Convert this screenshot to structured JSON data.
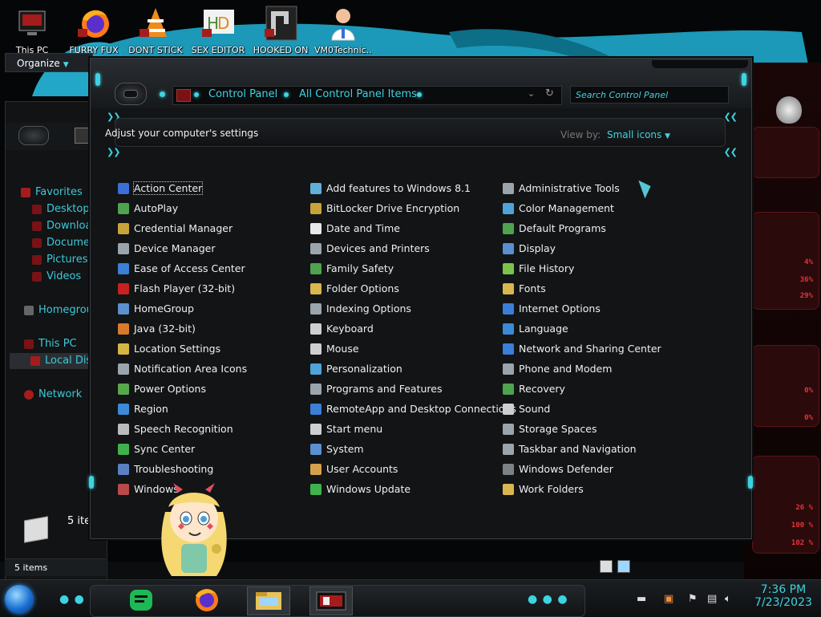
{
  "desktop": {
    "icons": [
      {
        "label": "This PC",
        "icon": "pc-icon"
      },
      {
        "label": "FURRY FUX",
        "icon": "firefox-shortcut-icon"
      },
      {
        "label": "DONT STICK",
        "icon": "vlc-shortcut-icon"
      },
      {
        "label": "SEX EDITOR",
        "icon": "hxd-shortcut-icon"
      },
      {
        "label": "HOOKED ON",
        "icon": "game-shortcut-icon"
      },
      {
        "label": "VM0Technic...",
        "icon": "doctor-avatar-icon"
      }
    ]
  },
  "background_explorer": {
    "organize_label": "Organize",
    "nav": [
      {
        "label": "Favorites",
        "icon": "star-icon"
      },
      {
        "label": "Desktop",
        "icon": "desktop-icon"
      },
      {
        "label": "Download",
        "icon": "download-icon"
      },
      {
        "label": "Documen",
        "icon": "documents-icon"
      },
      {
        "label": "Pictures",
        "icon": "pictures-icon"
      },
      {
        "label": "Videos",
        "icon": "videos-icon"
      },
      {
        "label": "Homegroup",
        "icon": "homegroup-icon"
      },
      {
        "label": "This PC",
        "icon": "pc-icon"
      },
      {
        "label": "Local Dis",
        "icon": "drive-icon"
      },
      {
        "label": "Network",
        "icon": "network-icon"
      }
    ],
    "preview_count": "5 ite",
    "status": "5 items"
  },
  "control_panel": {
    "breadcrumb": [
      "Control Panel",
      "All Control Panel Items"
    ],
    "search_placeholder": "Search Control Panel",
    "heading": "Adjust your computer's settings",
    "view_by_label": "View by:",
    "view_by_value": "Small icons",
    "columns": [
      [
        {
          "label": "Action Center",
          "icon": "flag-icon",
          "color": "#3b6fd6"
        },
        {
          "label": "AutoPlay",
          "icon": "autoplay-icon",
          "color": "#4fa34f"
        },
        {
          "label": "Credential Manager",
          "icon": "vault-icon",
          "color": "#c9a23a"
        },
        {
          "label": "Device Manager",
          "icon": "device-manager-icon",
          "color": "#9aa4ad"
        },
        {
          "label": "Ease of Access Center",
          "icon": "ease-of-access-icon",
          "color": "#3a7fd8"
        },
        {
          "label": "Flash Player (32-bit)",
          "icon": "flash-icon",
          "color": "#c7221f"
        },
        {
          "label": "HomeGroup",
          "icon": "homegroup-icon",
          "color": "#5a8fd0"
        },
        {
          "label": "Java (32-bit)",
          "icon": "java-icon",
          "color": "#d87a2a"
        },
        {
          "label": "Location Settings",
          "icon": "location-icon",
          "color": "#d6b543"
        },
        {
          "label": "Notification Area Icons",
          "icon": "notification-icon",
          "color": "#9aa4ad"
        },
        {
          "label": "Power Options",
          "icon": "power-icon",
          "color": "#56a84a"
        },
        {
          "label": "Region",
          "icon": "globe-icon",
          "color": "#3a8ad6"
        },
        {
          "label": "Speech Recognition",
          "icon": "microphone-icon",
          "color": "#bbbbbb"
        },
        {
          "label": "Sync Center",
          "icon": "sync-icon",
          "color": "#3fb24c"
        },
        {
          "label": "Troubleshooting",
          "icon": "troubleshoot-icon",
          "color": "#5a7fc2"
        },
        {
          "label": "Windows",
          "icon": "windows-mobility-icon",
          "color": "#b84a4a"
        }
      ],
      [
        {
          "label": "Add features to Windows 8.1",
          "icon": "add-features-icon",
          "color": "#5fb0d8"
        },
        {
          "label": "BitLocker Drive Encryption",
          "icon": "bitlocker-icon",
          "color": "#c9a23a"
        },
        {
          "label": "Date and Time",
          "icon": "clock-icon",
          "color": "#e8e8e8"
        },
        {
          "label": "Devices and Printers",
          "icon": "printer-icon",
          "color": "#9aa4ad"
        },
        {
          "label": "Family Safety",
          "icon": "family-icon",
          "color": "#4fa34f"
        },
        {
          "label": "Folder Options",
          "icon": "folder-options-icon",
          "color": "#d9b64e"
        },
        {
          "label": "Indexing Options",
          "icon": "indexing-icon",
          "color": "#9aa4ad"
        },
        {
          "label": "Keyboard",
          "icon": "keyboard-icon",
          "color": "#cfcfcf"
        },
        {
          "label": "Mouse",
          "icon": "mouse-icon",
          "color": "#cfcfcf"
        },
        {
          "label": "Personalization",
          "icon": "personalization-icon",
          "color": "#4fa3d8"
        },
        {
          "label": "Programs and Features",
          "icon": "programs-icon",
          "color": "#9aa4ad"
        },
        {
          "label": "RemoteApp and Desktop Connections",
          "icon": "remote-desktop-icon",
          "color": "#3a7fd8"
        },
        {
          "label": "Start menu",
          "icon": "start-menu-icon",
          "color": "#cfcfcf"
        },
        {
          "label": "System",
          "icon": "system-icon",
          "color": "#5a8fd0"
        },
        {
          "label": "User Accounts",
          "icon": "user-accounts-icon",
          "color": "#d6a04a"
        },
        {
          "label": "Windows Update",
          "icon": "windows-update-icon",
          "color": "#3fb24c"
        }
      ],
      [
        {
          "label": "Administrative Tools",
          "icon": "admin-tools-icon",
          "color": "#9aa4ad"
        },
        {
          "label": "Color Management",
          "icon": "color-management-icon",
          "color": "#4fa3d8"
        },
        {
          "label": "Default Programs",
          "icon": "default-programs-icon",
          "color": "#4fa34f"
        },
        {
          "label": "Display",
          "icon": "display-icon",
          "color": "#5a8fd0"
        },
        {
          "label": "File History",
          "icon": "file-history-icon",
          "color": "#7bc34a"
        },
        {
          "label": "Fonts",
          "icon": "fonts-icon",
          "color": "#d9b64e"
        },
        {
          "label": "Internet Options",
          "icon": "internet-options-icon",
          "color": "#3a7fd8"
        },
        {
          "label": "Language",
          "icon": "language-icon",
          "color": "#3a8ad6"
        },
        {
          "label": "Network and Sharing Center",
          "icon": "network-sharing-icon",
          "color": "#3a7fd8"
        },
        {
          "label": "Phone and Modem",
          "icon": "phone-modem-icon",
          "color": "#9aa4ad"
        },
        {
          "label": "Recovery",
          "icon": "recovery-icon",
          "color": "#4fa34f"
        },
        {
          "label": "Sound",
          "icon": "sound-icon",
          "color": "#cfcfcf"
        },
        {
          "label": "Storage Spaces",
          "icon": "storage-icon",
          "color": "#9aa4ad"
        },
        {
          "label": "Taskbar and Navigation",
          "icon": "taskbar-icon",
          "color": "#9aa4ad"
        },
        {
          "label": "Windows Defender",
          "icon": "defender-icon",
          "color": "#7a8288"
        },
        {
          "label": "Work Folders",
          "icon": "work-folders-icon",
          "color": "#d9b64e"
        }
      ]
    ],
    "focused_item": "Action Center"
  },
  "gadgets": {
    "readouts": [
      "4%",
      "36%",
      "29%",
      "0%",
      "0%",
      "26 %",
      "100 %",
      "102 %"
    ]
  },
  "taskbar": {
    "pinned": [
      {
        "name": "spotify",
        "icon": "spotify-icon"
      },
      {
        "name": "firefox",
        "icon": "firefox-icon"
      },
      {
        "name": "file-explorer",
        "icon": "file-explorer-icon"
      },
      {
        "name": "control-panel",
        "icon": "control-panel-icon"
      }
    ],
    "time": "7:36 PM",
    "date": "7/23/2023"
  },
  "colors": {
    "accent": "#3dd3e1",
    "frame": "#1a1d20",
    "alert_red": "#e2343a"
  }
}
